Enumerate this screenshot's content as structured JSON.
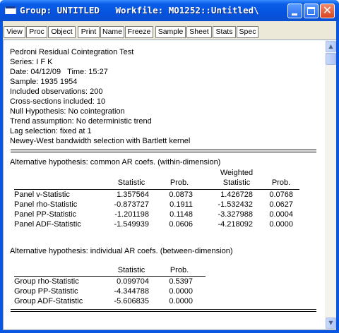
{
  "window": {
    "title": "Group: UNTITLED   Workfile: MO1252::Untitled\\"
  },
  "toolbar": {
    "buttons": [
      "View",
      "Proc",
      "Object",
      "Print",
      "Name",
      "Freeze",
      "Sample",
      "Sheet",
      "Stats",
      "Spec"
    ]
  },
  "header": {
    "lines": [
      "Pedroni Residual Cointegration Test",
      "Series: I F K",
      "Date: 04/12/09   Time: 15:27",
      "Sample: 1935 1954",
      "Included observations: 200",
      "Cross-sections included: 10",
      "Null Hypothesis: No cointegration",
      "Trend assumption: No deterministic trend",
      "Lag selection: fixed at 1",
      "Newey-West bandwidth selection with Bartlett kernel"
    ]
  },
  "within": {
    "title": "Alternative hypothesis: common AR coefs. (within-dimension)",
    "weighted_label": "Weighted",
    "columns": [
      "Statistic",
      "Prob.",
      "Statistic",
      "Prob."
    ],
    "rows": [
      {
        "label": "Panel v-Statistic",
        "stat": "1.357564",
        "prob": "0.0873",
        "wstat": "1.426728",
        "wprob": "0.0768"
      },
      {
        "label": "Panel rho-Statistic",
        "stat": "-0.873727",
        "prob": "0.1911",
        "wstat": "-1.532432",
        "wprob": "0.0627"
      },
      {
        "label": "Panel PP-Statistic",
        "stat": "-1.201198",
        "prob": "0.1148",
        "wstat": "-3.327988",
        "wprob": "0.0004"
      },
      {
        "label": "Panel ADF-Statistic",
        "stat": "-1.549939",
        "prob": "0.0606",
        "wstat": "-4.218092",
        "wprob": "0.0000"
      }
    ]
  },
  "between": {
    "title": "Alternative hypothesis: individual AR coefs. (between-dimension)",
    "columns": [
      "Statistic",
      "Prob."
    ],
    "rows": [
      {
        "label": "Group rho-Statistic",
        "stat": "0.099704",
        "prob": "0.5397"
      },
      {
        "label": "Group PP-Statistic",
        "stat": "-4.344788",
        "prob": "0.0000"
      },
      {
        "label": "Group ADF-Statistic",
        "stat": "-5.606835",
        "prob": "0.0000"
      }
    ]
  }
}
